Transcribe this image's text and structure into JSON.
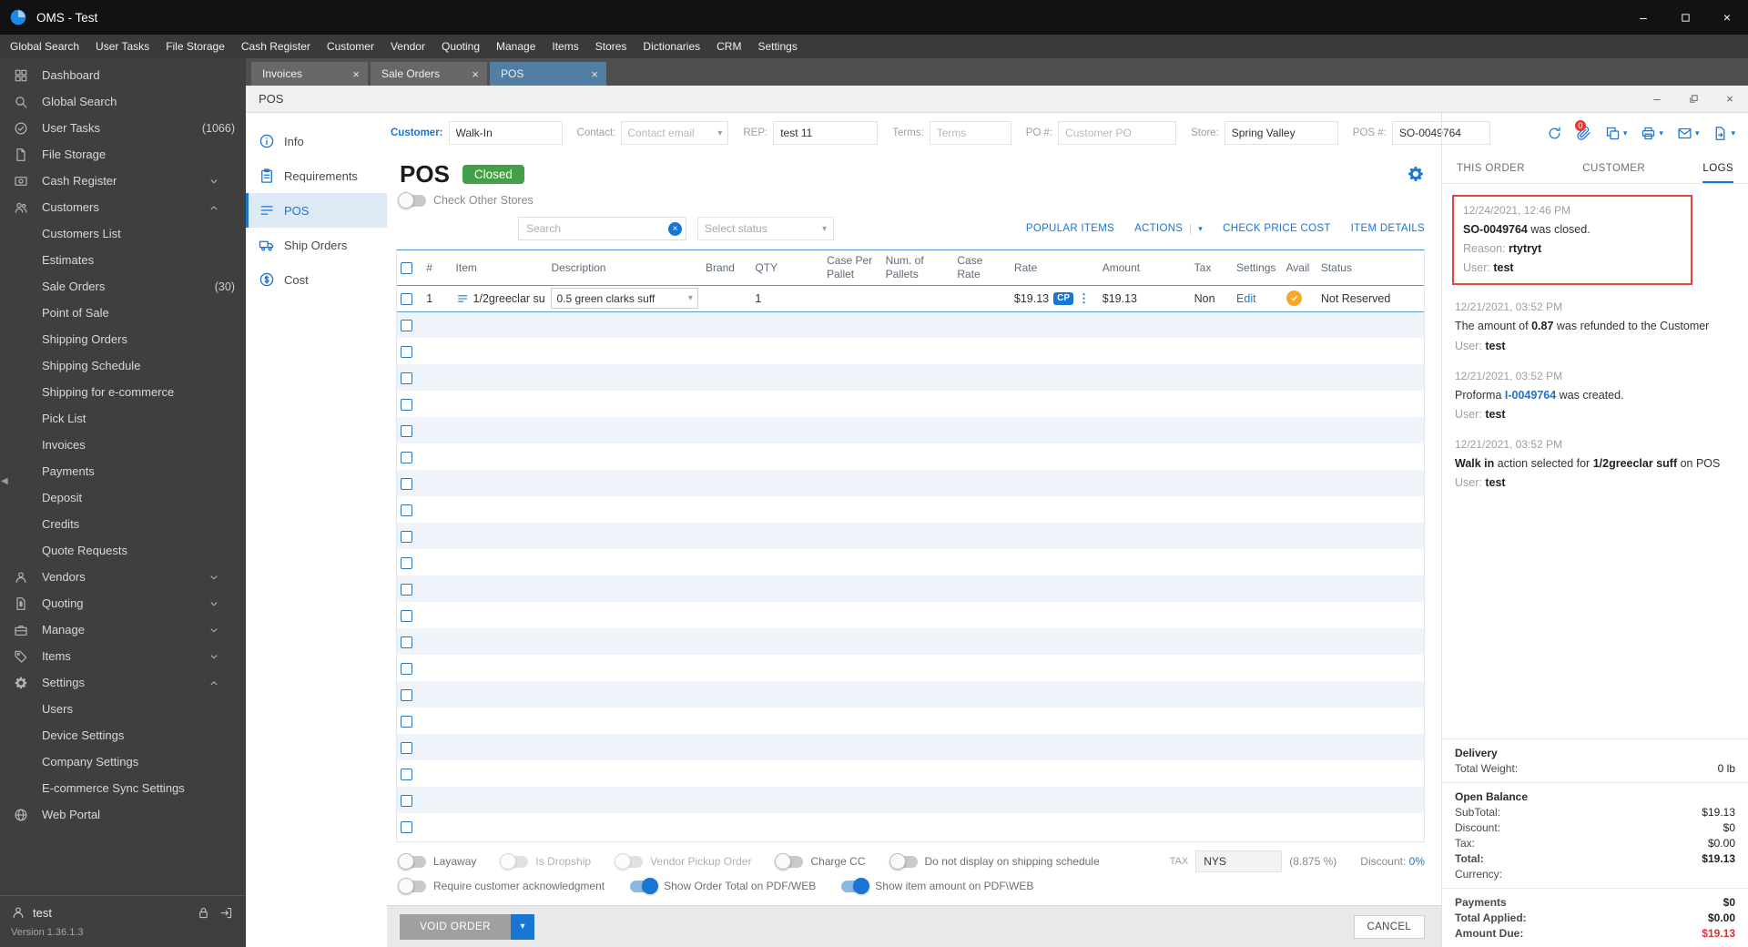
{
  "window": {
    "title": "OMS - Test",
    "menu": [
      "Global Search",
      "User Tasks",
      "File Storage",
      "Cash Register",
      "Customer",
      "Vendor",
      "Quoting",
      "Manage",
      "Items",
      "Stores",
      "Dictionaries",
      "CRM",
      "Settings"
    ]
  },
  "colors": {
    "accent": "#1976d2",
    "closed_badge": "#43a047",
    "log_highlight_border": "#e8453c",
    "amount_due": "#d6352c",
    "avail_indicator": "#f9a825"
  },
  "sidebar": {
    "items": [
      {
        "label": "Dashboard",
        "icon": "grid"
      },
      {
        "label": "Global Search",
        "icon": "search"
      },
      {
        "label": "User Tasks",
        "icon": "check-circle",
        "badge": "(1066)"
      },
      {
        "label": "File Storage",
        "icon": "file"
      },
      {
        "label": "Cash Register",
        "icon": "cash",
        "chevron": "down"
      },
      {
        "label": "Customers",
        "icon": "people",
        "chevron": "up"
      },
      {
        "label": "Customers List",
        "child": true
      },
      {
        "label": "Estimates",
        "child": true
      },
      {
        "label": "Sale Orders",
        "child": true,
        "badge": "(30)"
      },
      {
        "label": "Point of Sale",
        "child": true
      },
      {
        "label": "Shipping Orders",
        "child": true
      },
      {
        "label": "Shipping Schedule",
        "child": true
      },
      {
        "label": "Shipping for e-commerce",
        "child": true
      },
      {
        "label": "Pick List",
        "child": true
      },
      {
        "label": "Invoices",
        "child": true
      },
      {
        "label": "Payments",
        "child": true
      },
      {
        "label": "Deposit",
        "child": true
      },
      {
        "label": "Credits",
        "child": true
      },
      {
        "label": "Quote Requests",
        "child": true
      },
      {
        "label": "Vendors",
        "icon": "person",
        "chevron": "down"
      },
      {
        "label": "Quoting",
        "icon": "doc-dollar",
        "chevron": "down"
      },
      {
        "label": "Manage",
        "icon": "briefcase",
        "chevron": "down"
      },
      {
        "label": "Items",
        "icon": "tag",
        "chevron": "down"
      },
      {
        "label": "Settings",
        "icon": "gear",
        "chevron": "up"
      },
      {
        "label": "Users",
        "child": true
      },
      {
        "label": "Device Settings",
        "child": true
      },
      {
        "label": "Company Settings",
        "child": true
      },
      {
        "label": "E-commerce Sync Settings",
        "child": true
      },
      {
        "label": "Web Portal",
        "icon": "globe"
      }
    ],
    "user": "test",
    "version": "Version 1.36.1.3"
  },
  "tabs": [
    {
      "label": "Invoices"
    },
    {
      "label": "Sale Orders"
    },
    {
      "label": "POS",
      "active": true
    }
  ],
  "pos": {
    "window_title": "POS",
    "heading": "POS",
    "status": "Closed",
    "check_other_stores": "Check Other Stores",
    "search_placeholder": "Search",
    "status_placeholder": "Select status",
    "fields": [
      {
        "key": "customer",
        "label": "Customer:",
        "value": "Walk-In",
        "accent": true
      },
      {
        "key": "contact",
        "label": "Contact:",
        "placeholder": "Contact email",
        "dropdown": true
      },
      {
        "key": "rep",
        "label": "REP:",
        "value": "test 11"
      },
      {
        "key": "terms",
        "label": "Terms:",
        "placeholder": "Terms"
      },
      {
        "key": "po_number",
        "label": "PO #:",
        "placeholder": "Customer PO"
      },
      {
        "key": "store",
        "label": "Store:",
        "value": "Spring Valley"
      },
      {
        "key": "pos_number",
        "label": "POS #:",
        "value": "SO-0049764"
      }
    ],
    "nav": [
      {
        "label": "Info",
        "icon": "info"
      },
      {
        "label": "Requirements",
        "icon": "clipboard"
      },
      {
        "label": "POS",
        "icon": "pos-list",
        "active": true
      },
      {
        "label": "Ship Orders",
        "icon": "truck"
      },
      {
        "label": "Cost",
        "icon": "dollar-circle"
      }
    ],
    "toolbar_buttons": [
      {
        "label": "POPULAR ITEMS"
      },
      {
        "label": "ACTIONS",
        "split": true
      },
      {
        "label": "CHECK PRICE COST"
      },
      {
        "label": "ITEM DETAILS"
      }
    ],
    "table": {
      "columns": [
        "#",
        "Item",
        "Description",
        "Brand",
        "QTY",
        "Case Per Pallet",
        "Num. of Pallets",
        "Case Rate",
        "Rate",
        "Amount",
        "Tax",
        "Settings",
        "Avail",
        "Status"
      ],
      "rows": [
        {
          "num": "1",
          "item": "1/2greeclar su",
          "description": "0.5 green clarks suff",
          "brand": "",
          "qty": "1",
          "case_per_pallet": "",
          "num_of_pallets": "",
          "case_rate": "",
          "rate": "$19.13",
          "rate_badge": "CP",
          "amount": "$19.13",
          "tax": "Non",
          "settings": "Edit",
          "status": "Not Reserved"
        }
      ],
      "empty_row_count": 20
    },
    "toggles_row1": [
      {
        "label": "Layaway",
        "state": "off"
      },
      {
        "label": "Is Dropship",
        "state": "off",
        "disabled": true
      },
      {
        "label": "Vendor Pickup Order",
        "state": "off",
        "disabled": true
      },
      {
        "label": "Charge CC",
        "state": "off"
      },
      {
        "label": "Do not display on shipping schedule",
        "state": "off"
      }
    ],
    "toggles_row2": [
      {
        "label": "Require customer acknowledgment",
        "state": "off"
      },
      {
        "label": "Show Order Total on PDF/WEB",
        "state": "on"
      },
      {
        "label": "Show item amount on PDF\\WEB",
        "state": "on"
      }
    ],
    "tax": {
      "label": "TAX",
      "value": "NYS",
      "rate": "(8.875 %)"
    },
    "discount": {
      "label": "Discount:",
      "value": "0%"
    },
    "footer": {
      "void_label": "VOID ORDER",
      "cancel_label": "CANCEL"
    }
  },
  "right_panel": {
    "action_icons": [
      {
        "name": "refresh"
      },
      {
        "name": "paperclip",
        "badge": "0"
      },
      {
        "name": "copy",
        "caret": true
      },
      {
        "name": "print",
        "caret": true
      },
      {
        "name": "mail",
        "caret": true
      },
      {
        "name": "export",
        "caret": true
      }
    ],
    "tabs": [
      {
        "label": "THIS ORDER"
      },
      {
        "label": "CUSTOMER"
      },
      {
        "label": "LOGS",
        "active": true
      }
    ],
    "logs": [
      {
        "date": "12/24/2021, 12:46 PM",
        "highlighted": true,
        "lines": [
          [
            {
              "t": "SO-0049764",
              "s": "b"
            },
            {
              "t": " was closed.",
              "s": "n"
            }
          ],
          [
            {
              "t": "Reason: ",
              "s": "l"
            },
            {
              "t": "rtytryt",
              "s": "b"
            }
          ],
          [
            {
              "t": "User: ",
              "s": "l"
            },
            {
              "t": "test",
              "s": "b"
            }
          ]
        ]
      },
      {
        "date": "12/21/2021, 03:52 PM",
        "lines": [
          [
            {
              "t": "The amount of ",
              "s": "n"
            },
            {
              "t": "0.87",
              "s": "b"
            },
            {
              "t": " was refunded to the Customer",
              "s": "n"
            }
          ],
          [
            {
              "t": "User: ",
              "s": "l"
            },
            {
              "t": "test",
              "s": "b"
            }
          ]
        ]
      },
      {
        "date": "12/21/2021, 03:52 PM",
        "lines": [
          [
            {
              "t": "Proforma ",
              "s": "n"
            },
            {
              "t": "I-0049764",
              "s": "a"
            },
            {
              "t": " was created.",
              "s": "n"
            }
          ],
          [
            {
              "t": "User: ",
              "s": "l"
            },
            {
              "t": "test",
              "s": "b"
            }
          ]
        ]
      },
      {
        "date": "12/21/2021, 03:52 PM",
        "lines": [
          [
            {
              "t": "Walk in",
              "s": "b"
            },
            {
              "t": " action selected for ",
              "s": "n"
            },
            {
              "t": "1/2greeclar suff",
              "s": "b"
            },
            {
              "t": " on POS",
              "s": "n"
            }
          ],
          [
            {
              "t": "User: ",
              "s": "l"
            },
            {
              "t": "test",
              "s": "b"
            }
          ]
        ]
      }
    ],
    "summary": [
      {
        "header": "Delivery",
        "rows": [
          {
            "label": "Total Weight:",
            "value": "0 lb"
          }
        ]
      },
      {
        "header": "Open Balance",
        "rows": [
          {
            "label": "SubTotal:",
            "value": "$19.13"
          },
          {
            "label": "Discount:",
            "value": "$0"
          },
          {
            "label": "Tax:",
            "value": "$0.00"
          },
          {
            "label": "Total:",
            "value": "$19.13",
            "bold": true
          },
          {
            "label": "Currency:",
            "value": ""
          }
        ]
      },
      {
        "rows": [
          {
            "label": "Payments",
            "value": "$0",
            "bold": true
          },
          {
            "label": "Total Applied:",
            "value": "$0.00",
            "bold": true
          },
          {
            "label": "Amount Due:",
            "value": "$19.13",
            "bold": true,
            "red": true
          }
        ]
      }
    ]
  }
}
